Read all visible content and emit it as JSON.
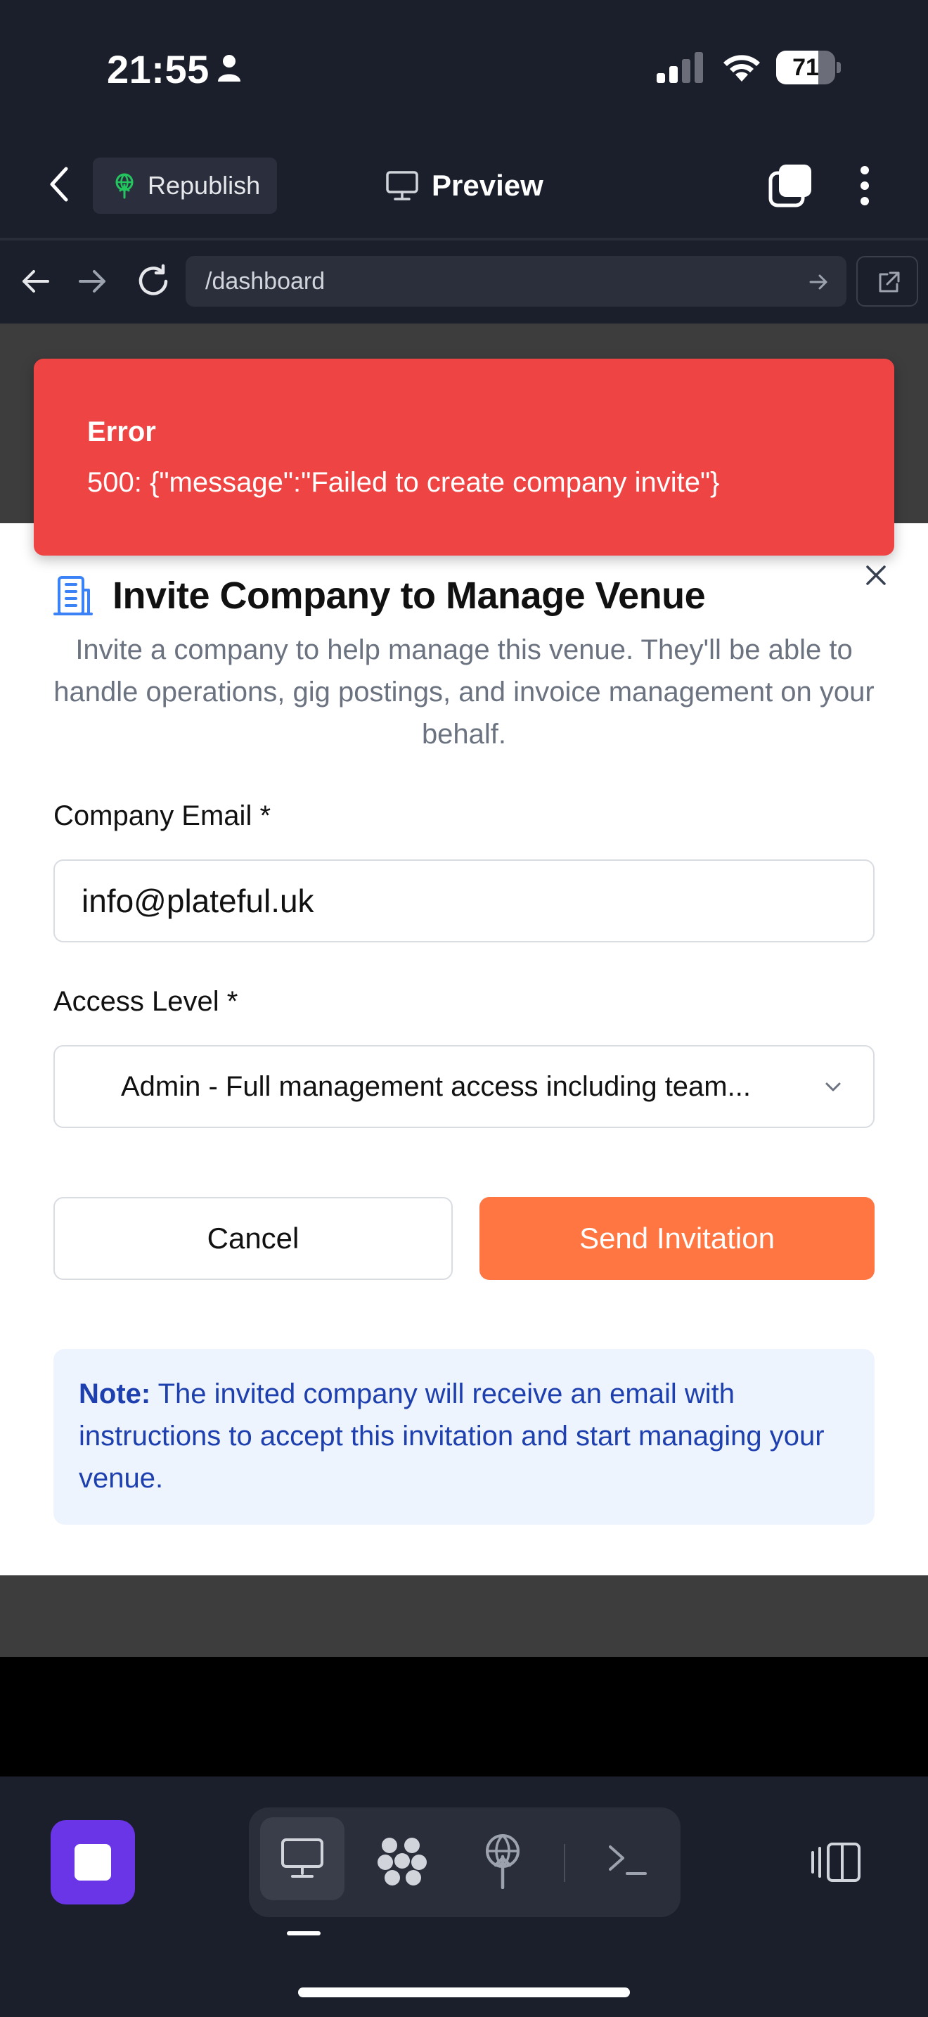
{
  "status_bar": {
    "time": "21:55",
    "battery": "71",
    "battery_level_percent": 71
  },
  "app_header": {
    "republish_label": "Republish",
    "preview_label": "Preview"
  },
  "browser": {
    "url": "/dashboard"
  },
  "error_toast": {
    "title": "Error",
    "message": "500: {\"message\":\"Failed to create company invite\"}"
  },
  "dialog": {
    "title": "Invite Company to Manage Venue",
    "description": "Invite a company to help manage this venue. They'll be able to handle operations, gig postings, and invoice management on your behalf.",
    "email_label": "Company Email *",
    "email_value": "info@plateful.uk",
    "access_label": "Access Level *",
    "access_value": "Admin - Full management access including team...",
    "cancel_label": "Cancel",
    "send_label": "Send Invitation",
    "note_strong": "Note:",
    "note_text": " The invited company will receive an email with instructions to accept this invitation and start managing your venue."
  },
  "colors": {
    "accent_orange": "#ff7643",
    "error_red": "#ef4444",
    "note_blue": "#1e40af",
    "stop_purple": "#6a35e6"
  },
  "icons": [
    "person-icon",
    "signal-icon",
    "wifi-icon",
    "back-icon",
    "republish-icon",
    "monitor-icon",
    "tabs-icon",
    "more-icon",
    "nav-back-icon",
    "nav-forward-icon",
    "reload-icon",
    "arrow-right-icon",
    "open-external-icon",
    "building-icon",
    "close-icon",
    "chevron-down-icon",
    "stop-icon",
    "desktop-icon",
    "apps-icon",
    "deploy-icon",
    "terminal-icon",
    "panel-icon"
  ]
}
